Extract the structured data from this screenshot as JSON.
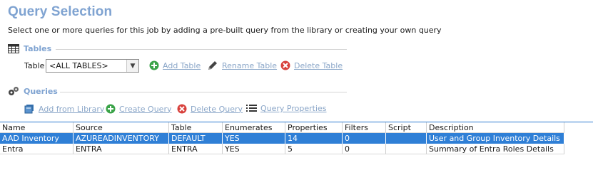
{
  "header": {
    "title": "Query Selection",
    "subtitle": "Select one or more queries for this job by adding a pre-built query from the library or creating your own query"
  },
  "tables_section": {
    "title": "Tables",
    "icon": "table-icon",
    "table_label": "Table",
    "table_select_value": "<ALL TABLES>",
    "actions": {
      "add": "Add Table",
      "rename": "Rename Table",
      "delete": "Delete Table"
    }
  },
  "queries_section": {
    "title": "Queries",
    "icon": "gears-icon",
    "actions": {
      "add_from_library": "Add from Library",
      "create": "Create Query",
      "delete": "Delete Query",
      "properties": "Query Properties"
    }
  },
  "grid": {
    "columns": [
      "Name",
      "Source",
      "Table",
      "Enumerates",
      "Properties",
      "Filters",
      "Script",
      "Description"
    ],
    "rows": [
      [
        "AAD Inventory",
        "AZUREADINVENTORY",
        "DEFAULT",
        "YES",
        "14",
        "0",
        "",
        "User and Group Inventory Details"
      ],
      [
        "Entra",
        "ENTRA",
        "ENTRA",
        "YES",
        "5",
        "0",
        "",
        "Summary of Entra Roles Details"
      ]
    ],
    "selected_row": 0
  },
  "colors": {
    "title": "#7fa3d1",
    "link": "#8aa6c8",
    "selection": "#2f7fd6",
    "add_green": "#3aa348",
    "delete_red": "#d8413c"
  }
}
